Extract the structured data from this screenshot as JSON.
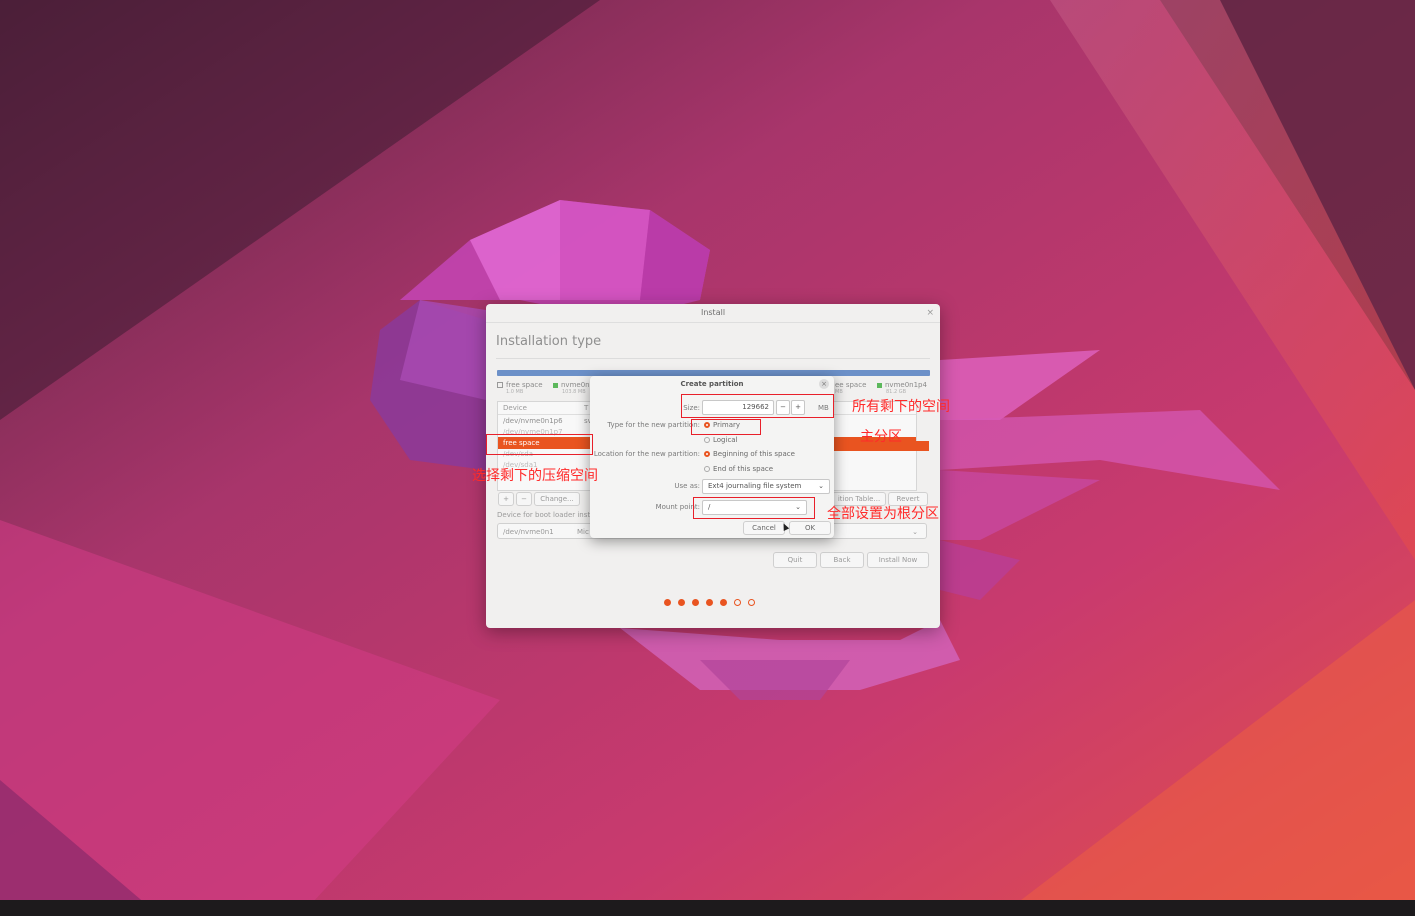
{
  "installer": {
    "window_title": "Install",
    "close_glyph": "×",
    "page_title": "Installation type",
    "legend": [
      {
        "label": "free space",
        "size": "1.0 MB",
        "swatch": "empty"
      },
      {
        "label": "nvme0n",
        "size": "103.8 MB",
        "swatch": "#5cb85c"
      },
      {
        "label": "ee space",
        "size": "MB",
        "swatch": "empty"
      },
      {
        "label": "nvme0n1p4",
        "size": "81.2 GB",
        "swatch": "#5cb85c"
      }
    ],
    "table": {
      "header": {
        "device": "Device",
        "type": "T"
      },
      "rows": [
        {
          "device": "/dev/nvme0n1p6",
          "type": "sv"
        },
        {
          "device": "/dev/nvme0n1p7",
          "type": ""
        },
        {
          "device": "free space",
          "type": ""
        },
        {
          "device": "/dev/sda",
          "type": ""
        },
        {
          "device": "/dev/sda1",
          "type": ""
        }
      ]
    },
    "buttons": {
      "add": "+",
      "remove": "−",
      "change": "Change...",
      "new_table": "ition Table...",
      "revert": "Revert"
    },
    "boot_loader": {
      "label": "Device for boot loader inst",
      "device": "/dev/nvme0n1",
      "description": "Mic"
    },
    "nav": {
      "quit": "Quit",
      "back": "Back",
      "install_now": "Install Now"
    },
    "progress": {
      "total_steps": 7,
      "completed_steps": 5
    },
    "accent": "#e95420"
  },
  "dialog": {
    "title": "Create partition",
    "close_glyph": "×",
    "size_label": "Size:",
    "size_value": "129662",
    "size_decrement": "−",
    "size_increment": "+",
    "size_unit": "MB",
    "type_label": "Type for the new partition:",
    "type_options": [
      {
        "label": "Primary",
        "selected": true
      },
      {
        "label": "Logical",
        "selected": false
      }
    ],
    "location_label": "Location for the new partition:",
    "location_options": [
      {
        "label": "Beginning of this space",
        "selected": true
      },
      {
        "label": "End of this space",
        "selected": false
      }
    ],
    "use_as_label": "Use as:",
    "use_as_value": "Ext4 journaling file system",
    "mount_label": "Mount point:",
    "mount_value": "/",
    "cancel": "Cancel",
    "ok": "OK"
  },
  "annotations": {
    "size_note": "所有剩下的空间",
    "primary_note": "主分区",
    "free_space_note": "选择剩下的压缩空间",
    "mount_note": "全部设置为根分区",
    "color": "#ff2a2a"
  }
}
